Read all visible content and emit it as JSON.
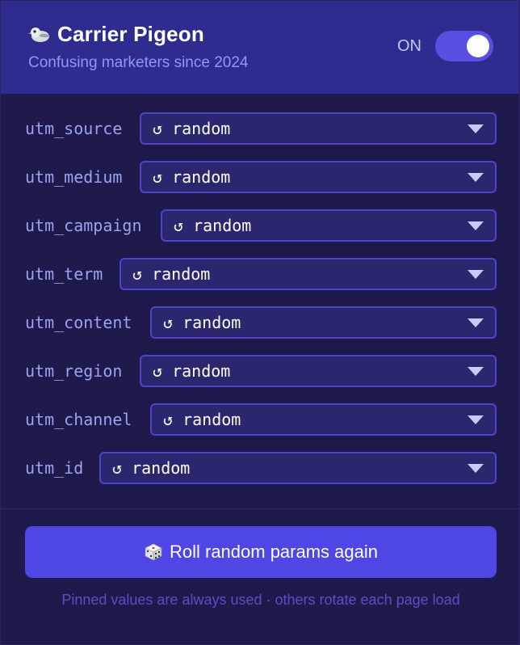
{
  "header": {
    "title": "Carrier Pigeon",
    "subtitle": "Confusing marketers since 2024",
    "toggle_label": "ON",
    "toggle_on": true,
    "logo_icon": "pigeon-icon"
  },
  "params": [
    {
      "name": "utm_source",
      "value": "↺ random"
    },
    {
      "name": "utm_medium",
      "value": "↺ random"
    },
    {
      "name": "utm_campaign",
      "value": "↺ random"
    },
    {
      "name": "utm_term",
      "value": "↺ random"
    },
    {
      "name": "utm_content",
      "value": "↺ random"
    },
    {
      "name": "utm_region",
      "value": "↺ random"
    },
    {
      "name": "utm_channel",
      "value": "↺ random"
    },
    {
      "name": "utm_id",
      "value": "↺ random"
    }
  ],
  "roll_button": {
    "label": "Roll random params again",
    "icon": "dice-icon"
  },
  "footer_note": "Pinned values are always used · others rotate each page load",
  "colors": {
    "background": "#1e1a4c",
    "header": "#302b8f",
    "accent": "#4f46e5",
    "label": "#9aa3ee"
  }
}
